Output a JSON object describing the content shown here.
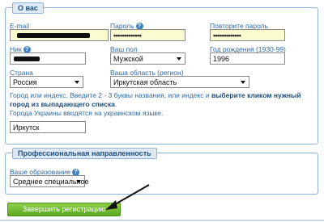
{
  "about_section": {
    "legend": "О вас",
    "email": {
      "label": "E-mail",
      "value": ""
    },
    "password": {
      "label": "Пароль",
      "value": "•••••••••••••"
    },
    "password_repeat": {
      "label": "Повторите пароль",
      "value": "•••••••••••••"
    },
    "nick": {
      "label": "Ник",
      "value": ""
    },
    "gender": {
      "label": "Ваш пол",
      "value": "Мужской"
    },
    "birth_year": {
      "label": "Год рождения (1930-99)",
      "value": "1996"
    },
    "country": {
      "label": "Страна",
      "value": "Россия"
    },
    "region": {
      "label": "Ваша область (регион)",
      "value": "Иркутская область"
    },
    "city_hint_part1": "Город или индекс. Введите 2 - 3 буквы названия, или индекс и ",
    "city_hint_bold": "выберите кликом нужный город из выпадающего списка",
    "city_hint_part2": ".",
    "city_hint_ukraine": "Города Украины вводятся на украинском языке.",
    "city": {
      "value": "Иркутск"
    }
  },
  "prof_section": {
    "legend": "Профессиональная направленность",
    "education": {
      "label": "Ваше образование",
      "value": "Среднее специальное"
    }
  },
  "submit_label": "Завершить регистрацию",
  "help_glyph": "?",
  "colors": {
    "label": "#2d6aa6",
    "legend_bg": "#dfe9f5",
    "border": "#8fb3d6",
    "submit_bg": "#6bb82a",
    "highlight_input": "#fbfbd0"
  }
}
